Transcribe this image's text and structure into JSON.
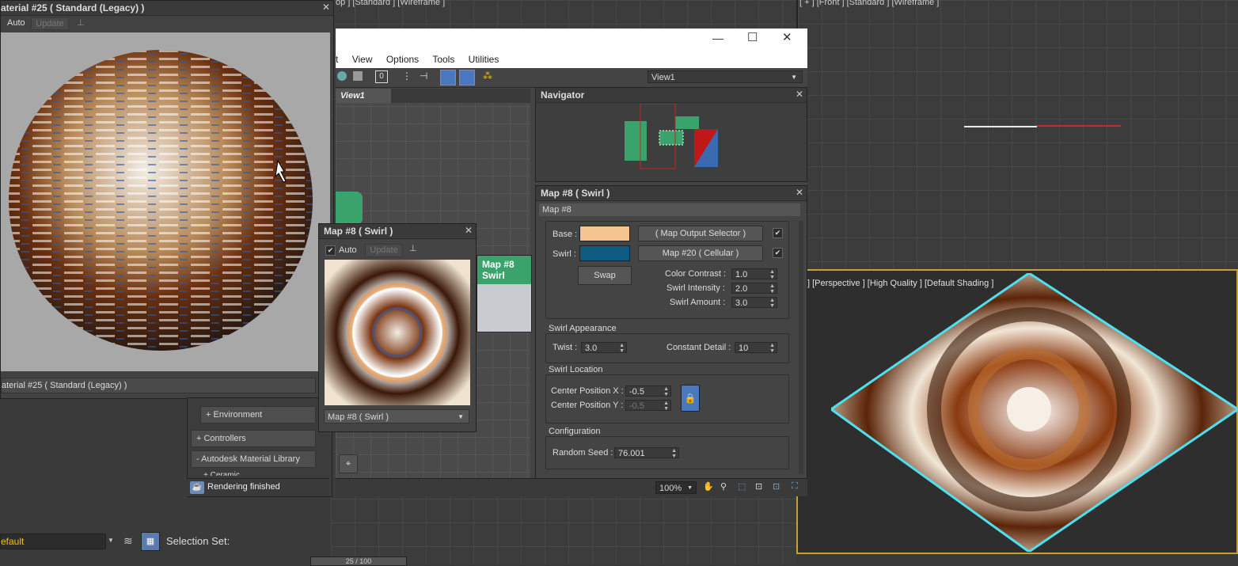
{
  "background_viewports": {
    "top_left_label": "op ] [Standard ] [Wireframe ]",
    "top_right_label": "[ + ] [Front ] [Standard ] [Wireframe ]",
    "perspective_label": "] [Perspective ] [High Quality ] [Default Shading ]",
    "time_slider": "25 / 100"
  },
  "material_window": {
    "title": "aterial #25 ( Standard (Legacy) )",
    "auto_label": "Auto",
    "update_label": "Update",
    "footer_name": "aterial #25 ( Standard (Legacy) )"
  },
  "browser": {
    "items": [
      "+ Environment",
      "+ Controllers",
      "- Autodesk Material Library",
      "+ Ceramic"
    ],
    "status": "Rendering finished"
  },
  "bottom_bar": {
    "layer_value": "efault",
    "selection_set_label": "Selection Set:"
  },
  "slate_editor": {
    "menu": [
      "t",
      "View",
      "Options",
      "Tools",
      "Utilities"
    ],
    "view_dropdown": "View1",
    "view_tab": "View1",
    "node_title_line1": "Map #8",
    "node_title_line2": "Swirl",
    "zoom": "100%"
  },
  "navigator": {
    "title": "Navigator"
  },
  "swirl_preview": {
    "title": "Map #8 ( Swirl )",
    "auto_label": "Auto",
    "update_label": "Update",
    "dropdown": "Map #8 ( Swirl )"
  },
  "param_panel": {
    "title": "Map #8 ( Swirl )",
    "name_field": "Map #8",
    "base_label": "Base :",
    "base_color": "#f4c491",
    "base_map": "( Map Output Selector )",
    "swirl_label": "Swirl :",
    "swirl_color": "#0e5a80",
    "swirl_map": "Map #20 ( Cellular )",
    "swap_label": "Swap",
    "color_contrast_label": "Color Contrast :",
    "color_contrast": "1.0",
    "swirl_intensity_label": "Swirl Intensity :",
    "swirl_intensity": "2.0",
    "swirl_amount_label": "Swirl Amount :",
    "swirl_amount": "3.0",
    "appearance_group": "Swirl Appearance",
    "twist_label": "Twist :",
    "twist": "3.0",
    "constant_detail_label": "Constant Detail :",
    "constant_detail": "10",
    "location_group": "Swirl Location",
    "center_x_label": "Center Position X :",
    "center_x": "-0.5",
    "center_y_label": "Center Position Y :",
    "center_y": "-0.5",
    "config_group": "Configuration",
    "random_seed_label": "Random Seed :",
    "random_seed": "76.001"
  },
  "colors": {
    "accent_blue": "#4a78c0",
    "node_green": "#3aa36b",
    "selection_cyan": "#4fe0f0"
  }
}
